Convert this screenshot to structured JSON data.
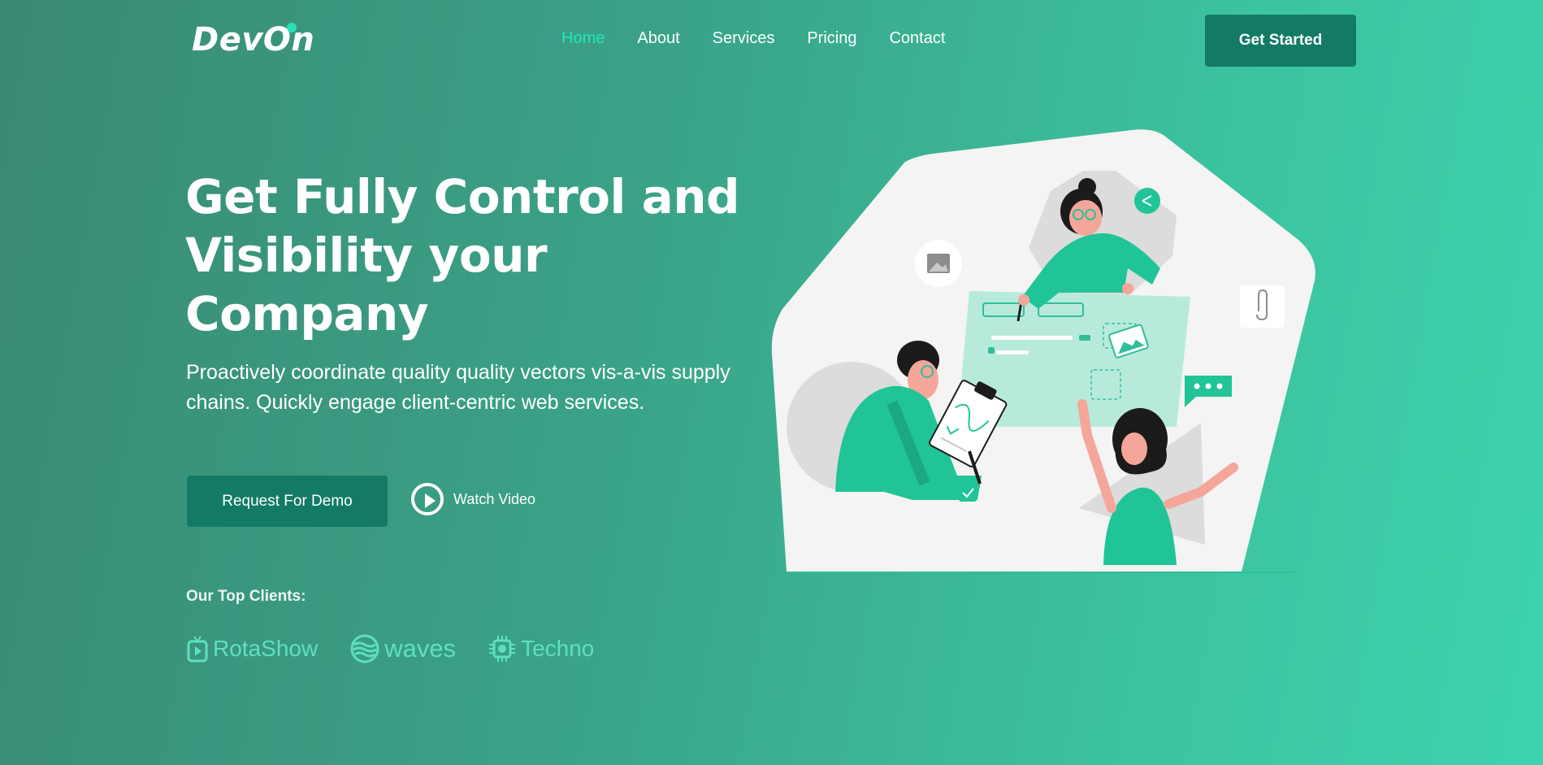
{
  "header": {
    "logo_text": "DevOn",
    "nav": [
      {
        "label": "Home",
        "active": true
      },
      {
        "label": "About",
        "active": false
      },
      {
        "label": "Services",
        "active": false
      },
      {
        "label": "Pricing",
        "active": false
      },
      {
        "label": "Contact",
        "active": false
      }
    ],
    "cta_label": "Get Started"
  },
  "hero": {
    "title_lines": [
      "Get Fully Control and",
      "Visibility your",
      "Company"
    ],
    "subtitle_lines": [
      "Proactively coordinate quality quality vectors vis-a-vis supply",
      "chains. Quickly engage client-centric web services."
    ],
    "demo_button": "Request For Demo",
    "watch_video": "Watch Video"
  },
  "clients": {
    "heading": "Our Top Clients:",
    "items": [
      {
        "name": "RotaShow",
        "icon": "tv-icon"
      },
      {
        "name": "waves",
        "icon": "waves-icon"
      },
      {
        "name": "Techno",
        "icon": "chip-icon"
      }
    ]
  },
  "colors": {
    "accent": "#24e6bb",
    "button": "#137a66",
    "gradient_start": "#3a8a74",
    "gradient_end": "#3dd3ad",
    "client_logo": "#5fe0be"
  }
}
